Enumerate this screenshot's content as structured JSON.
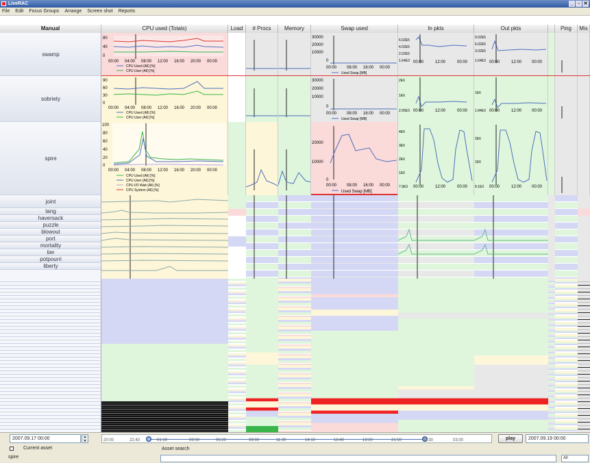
{
  "window": {
    "title": "LiveRAC",
    "controls": [
      "_",
      "▫",
      "✕"
    ]
  },
  "menu": [
    "File",
    "Edit",
    "Focus Groups",
    "Arrange",
    "Screen shot",
    "Reports"
  ],
  "columns": [
    {
      "label": "Manual"
    },
    {
      "label": "CPU used (Totals)"
    },
    {
      "label": "Load"
    },
    {
      "label": "# Procs"
    },
    {
      "label": "Memory"
    },
    {
      "label": "Swap used"
    },
    {
      "label": "In pkts"
    },
    {
      "label": "Out pkts"
    },
    {
      "label": ""
    },
    {
      "label": "Ping"
    },
    {
      "label": "Mis"
    }
  ],
  "rows": {
    "large": [
      "swamp",
      "sobriety",
      "spire"
    ],
    "small": [
      "joint",
      "tang",
      "haversack",
      "puzzle",
      "blowout",
      "port",
      "mortality",
      "tier",
      "potpourri",
      "liberty"
    ]
  },
  "cpu_panels": {
    "swamp": {
      "y_ticks": [
        "80",
        "40",
        "0"
      ],
      "x_ticks": [
        "00:00",
        "04:00",
        "08:00",
        "12:00",
        "16:00",
        "20:00",
        "00:00"
      ],
      "legend": [
        "CPU Used (All) [%]",
        "CPU User (All) [%]"
      ]
    },
    "sobriety": {
      "y_ticks": [
        "90",
        "60",
        "30",
        "0"
      ],
      "x_ticks": [
        "00:00",
        "04:00",
        "08:00",
        "12:00",
        "16:00",
        "20:00",
        "00:00"
      ],
      "legend": [
        "CPU Used (All) [%]",
        "CPU User (All) [%]"
      ]
    },
    "spire": {
      "y_ticks": [
        "100",
        "80",
        "60",
        "40",
        "20",
        "0"
      ],
      "x_ticks": [
        "00:00",
        "04:00",
        "08:00",
        "12:00",
        "16:00",
        "20:00",
        "00:00"
      ],
      "legend": [
        "CPU Used (All) [%]",
        "CPU User (All) [%]",
        "CPU I/O Wait (All) [%]",
        "CPU System (All) [%]"
      ]
    }
  },
  "swap_panels": {
    "swamp": {
      "y_ticks": [
        "30000",
        "20000",
        "10000",
        "0"
      ],
      "x_ticks": [
        "00:00",
        "08:00",
        "16:00",
        "00:00"
      ],
      "legend": "Used Swap [MB]"
    },
    "sobriety": {
      "y_ticks": [
        "30000",
        "20000",
        "10000",
        "0"
      ],
      "x_ticks": [
        "00:00",
        "08:00",
        "16:00",
        "00:00"
      ],
      "legend": "Used Swap [MB]"
    },
    "spire": {
      "y_ticks": [
        "20000",
        "10000",
        "0"
      ],
      "x_ticks": [
        "00:00",
        "08:00",
        "16:00",
        "00:00"
      ],
      "legend": "Used Swap [MB]"
    }
  },
  "inpkts_panels": {
    "swamp": {
      "y_ticks": [
        "6.02E5",
        "4.02E5",
        "2.02E5",
        "1.64E3"
      ],
      "x_ticks": [
        "00:00",
        "12:00",
        "00:00"
      ]
    },
    "sobriety": {
      "y_ticks": [
        "2E6",
        "1E6",
        "2.05E3"
      ],
      "x_ticks": [
        "00:00",
        "12:00",
        "00:00"
      ]
    },
    "spire": {
      "y_ticks": [
        "4E6",
        "3E6",
        "2E6",
        "1E6",
        "7.9E3"
      ],
      "x_ticks": [
        "00:00",
        "12:00",
        "00:00"
      ]
    }
  },
  "outpkts_panels": {
    "swamp": {
      "y_ticks": [
        "9.02E5",
        "6.02E5",
        "3.02E5",
        "1.64E3"
      ],
      "x_ticks": [
        "00:00",
        "12:00",
        "00:00"
      ]
    },
    "sobriety": {
      "y_ticks": [
        "1E6",
        "1.84E3"
      ],
      "x_ticks": [
        "00:00",
        "12:00",
        "00:00"
      ]
    },
    "spire": {
      "y_ticks": [
        "2E6",
        "1E6",
        "8.1E3"
      ],
      "x_ticks": [
        "00:00",
        "12:00",
        "00:00"
      ]
    }
  },
  "timebar": {
    "start": "2007.09.17 00:00",
    "end": "2007.09.19 00:00",
    "ticks": [
      "20:00",
      "22:40",
      "01:10",
      "03:50",
      "06:20",
      "09:00",
      "11:30",
      "14:10",
      "16:40",
      "19:20",
      "21:50",
      "00:30",
      "03:00"
    ],
    "play_label": "play",
    "range_start_fraction": 0.12,
    "range_end_fraction": 0.83
  },
  "bottom": {
    "current_asset_label": "Current asset",
    "current_asset_value": "spire",
    "asset_search_label": "Asset search",
    "search_value": "",
    "filter_value": "All"
  },
  "colors": {
    "critical": "#fbdada",
    "warning": "#fef6d8",
    "normal": "#dff6dc",
    "neutral": "#e8e8e8",
    "unknown": "#d5d8f5",
    "alert_red": "#ee2222",
    "series_blue": "#4d6fbd",
    "series_green": "#39b54a"
  }
}
